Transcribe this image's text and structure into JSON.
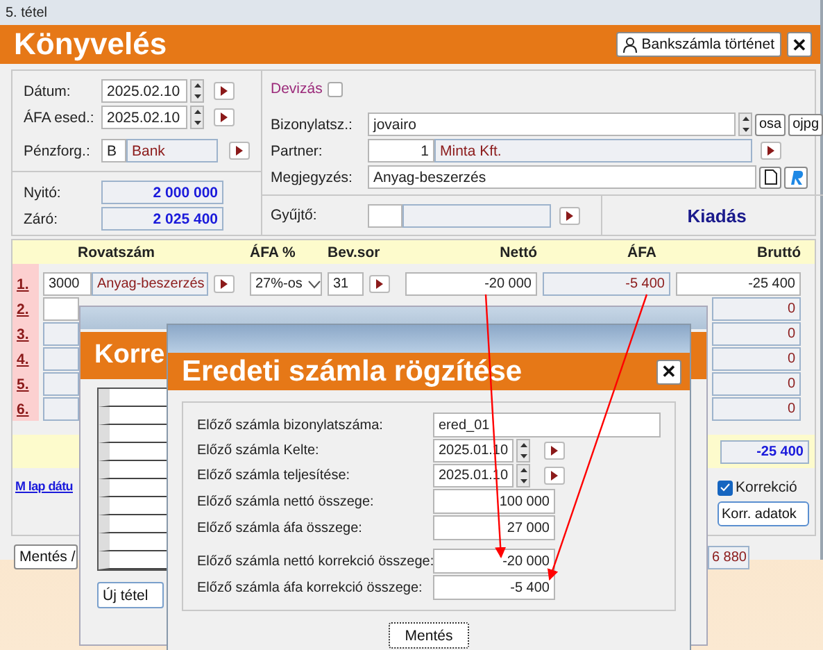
{
  "window": {
    "title": "5. tétel",
    "heading": "Könyvelés",
    "history_button": "Bankszámla történet",
    "close": "✕"
  },
  "left_panel": {
    "dates": [
      {
        "label": "Dátum:",
        "value": "2025.02.10"
      },
      {
        "label": "ÁFA esed.:",
        "value": "2025.02.10"
      }
    ],
    "payment": {
      "label": "Pénzforg.:",
      "code": "B",
      "name": "Bank"
    },
    "balances": [
      {
        "label": "Nyitó:",
        "value": "2 000 000"
      },
      {
        "label": "Záró:",
        "value": "2 025 400"
      }
    ]
  },
  "right_panel": {
    "currency": {
      "label": "Devizás",
      "checked": false
    },
    "document_no": {
      "label": "Bizonylatsz.:",
      "value": "jovairo",
      "buttons": [
        "osa",
        "ojpg"
      ]
    },
    "partner": {
      "label": "Partner:",
      "code": "1",
      "name": "Minta Kft."
    },
    "note": {
      "label": "Megjegyzés:",
      "value": "Anyag-beszerzés"
    },
    "collector": {
      "label": "Gyűjtő:"
    },
    "direction": "Kiadás"
  },
  "table": {
    "columns": [
      "Rovatszám",
      "ÁFA %",
      "Bev.sor",
      "Nettó",
      "ÁFA",
      "Bruttó"
    ],
    "rows": [
      {
        "no": "1.",
        "account": "3000",
        "account_name": "Anyag-beszerzés",
        "vat_rate": "27%-os",
        "line": "31",
        "net": "-20 000",
        "vat": "-5 400",
        "gross": "-25 400"
      },
      {
        "no": "2.",
        "gross": "0"
      },
      {
        "no": "3.",
        "gross": "0"
      },
      {
        "no": "4.",
        "gross": "0"
      },
      {
        "no": "5.",
        "gross": "0"
      },
      {
        "no": "6.",
        "gross": "0"
      }
    ],
    "total": "-25 400"
  },
  "link": "M lap dátu",
  "correction": {
    "label": "Korrekció",
    "checked": true,
    "button": "Korr. adatok"
  },
  "bottom": {
    "save_button": "Mentés /",
    "amount": "6 880"
  },
  "correction_window": {
    "heading": "Korre",
    "new_button": "Új tétel"
  },
  "dialog": {
    "title": "Eredeti számla rögzítése",
    "close": "✕",
    "fields": [
      {
        "kind": "text",
        "label": "Előző számla bizonylatszáma:",
        "value": "ered_01"
      },
      {
        "kind": "date",
        "label": "Előző számla Kelte:",
        "value": "2025.01.10"
      },
      {
        "kind": "date",
        "label": "Előző számla teljesítése:",
        "value": "2025.01.10"
      },
      {
        "kind": "amount",
        "label": "Előző számla nettó összege:",
        "value": "100 000"
      },
      {
        "kind": "amount",
        "label": "Előző számla áfa összege:",
        "value": "27 000"
      },
      {
        "kind": "gap"
      },
      {
        "kind": "amount",
        "label": "Előző számla nettó korrekció összege:",
        "value": "-20 000"
      },
      {
        "kind": "amount",
        "label": "Előző számla áfa korrekció összege:",
        "value": "-5 400"
      }
    ],
    "save_button": "Mentés"
  }
}
